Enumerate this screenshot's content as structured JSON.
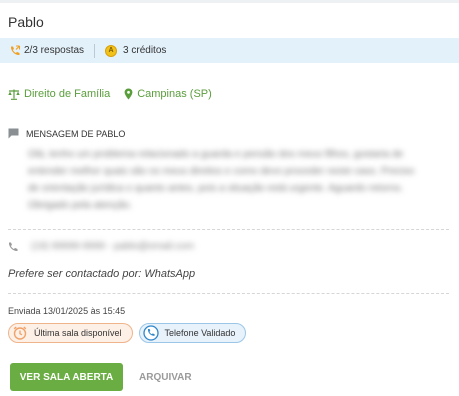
{
  "lead": {
    "name": "Pablo"
  },
  "info": {
    "responses": "2/3 respostas",
    "credits": "3 créditos",
    "coin_symbol": "A"
  },
  "tags": {
    "area": "Direito de Família",
    "location": "Campinas (SP)"
  },
  "message": {
    "heading": "MENSAGEM DE PABLO",
    "blurred_lines": [
      "Olá, tenho um problema relacionado a guarda e pensão dos meus filhos, gostaria de",
      "entender melhor quais são os meus direitos e como devo proceder neste caso. Preciso",
      "de orientação jurídica o quanto antes, pois a situação está urgente. Aguardo retorno.",
      "Obrigado pela atenção."
    ]
  },
  "contact": {
    "phone_blurred": "(19) 99999-9999  -  pablo@email.com",
    "preference": "Prefere ser contactado por: WhatsApp"
  },
  "sent": "Enviada 13/01/2025 às 15:45",
  "badges": {
    "last_room": "Última sala disponível",
    "phone_validated": "Telefone Validado"
  },
  "actions": {
    "primary": "VER SALA ABERTA",
    "secondary": "ARQUIVAR"
  },
  "colors": {
    "accent_green": "#6aad43",
    "info_bar": "#e3f1fb",
    "orange_badge": "#f0a26a",
    "blue_badge": "#2f86c9"
  }
}
